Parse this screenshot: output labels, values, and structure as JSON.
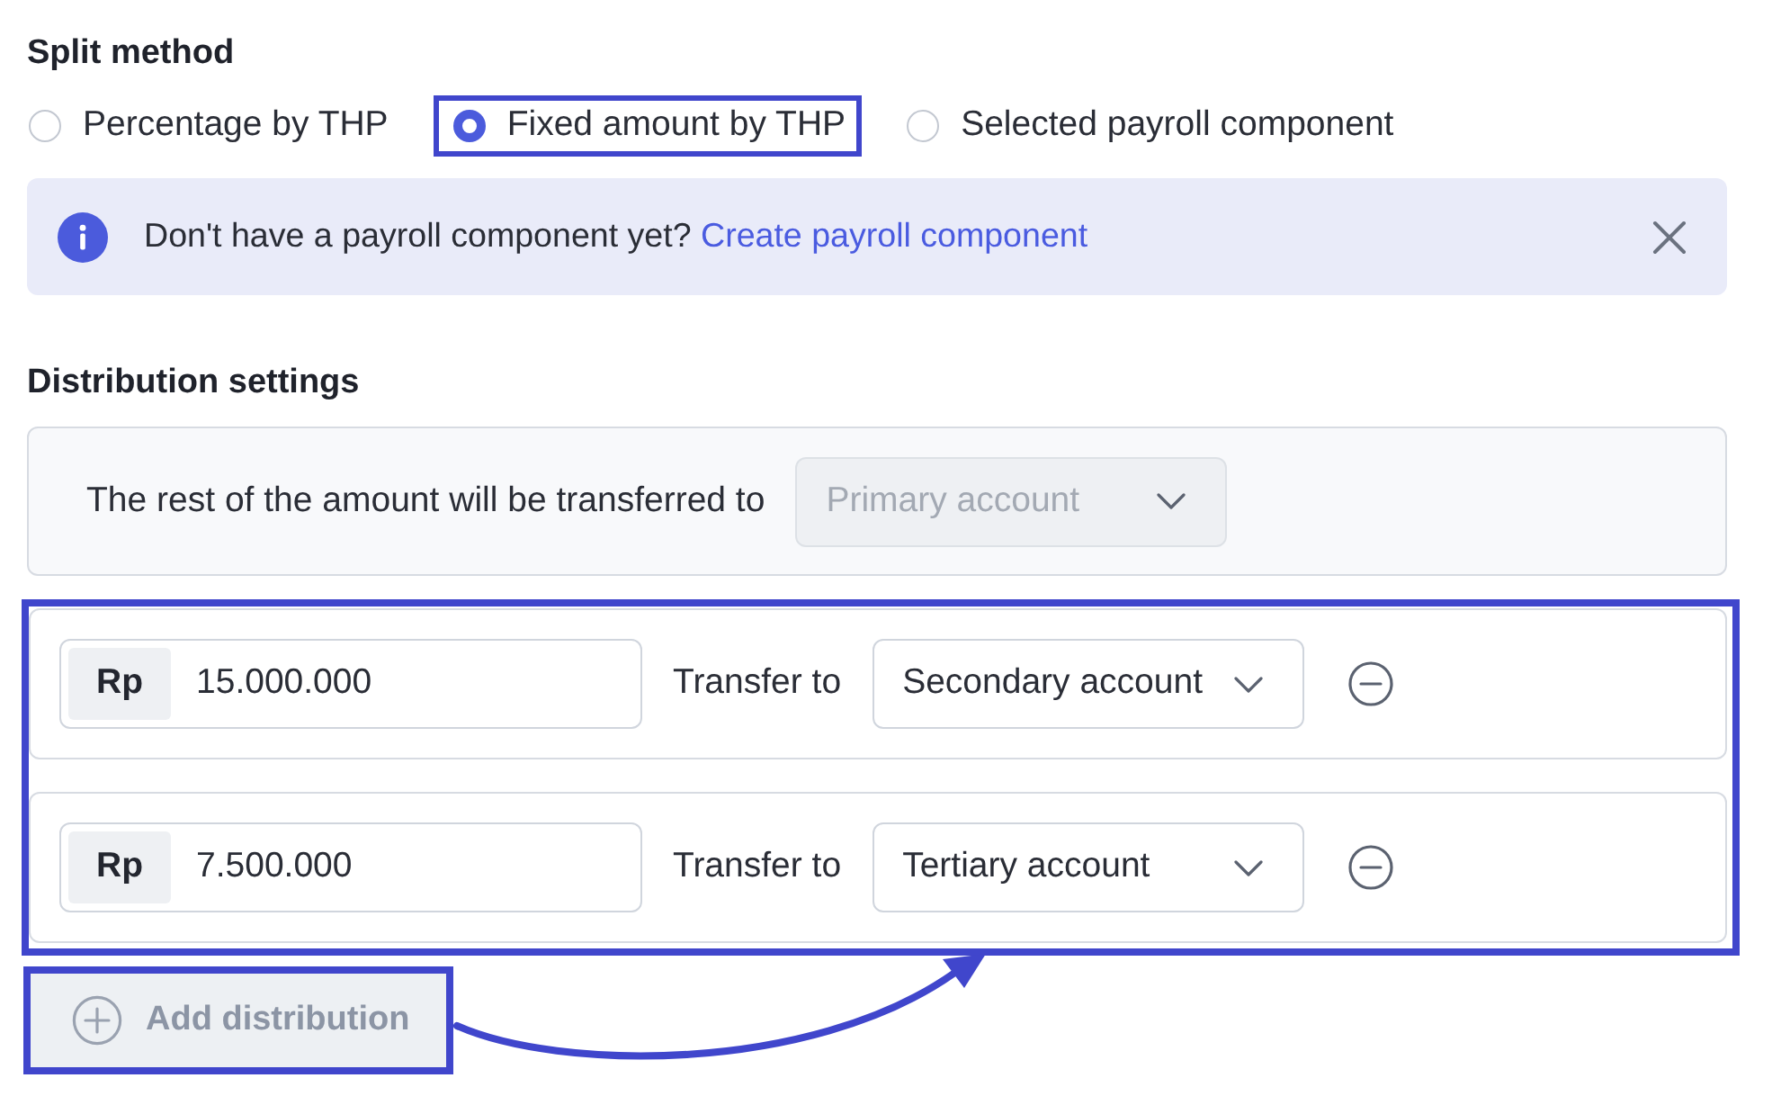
{
  "split_method": {
    "title": "Split method",
    "options": [
      {
        "label": "Percentage by THP",
        "selected": false,
        "highlighted": false
      },
      {
        "label": "Fixed amount by THP",
        "selected": true,
        "highlighted": true
      },
      {
        "label": "Selected payroll component",
        "selected": false,
        "highlighted": false
      }
    ]
  },
  "alert": {
    "message": "Don't have a payroll component yet?",
    "link": "Create payroll component"
  },
  "distribution_settings": {
    "title": "Distribution settings",
    "rest_label": "The rest of the amount will be transferred to",
    "rest_account": {
      "value": "Primary account",
      "disabled": true
    },
    "highlighted": true,
    "distributions": [
      {
        "currency": "Rp",
        "amount": "15.000.000",
        "transfer_label": "Transfer to",
        "account": "Secondary account"
      },
      {
        "currency": "Rp",
        "amount": "7.500.000",
        "transfer_label": "Transfer to",
        "account": "Tertiary account"
      }
    ],
    "add_button": {
      "label": "Add distribution",
      "disabled": true,
      "highlighted": true
    }
  }
}
